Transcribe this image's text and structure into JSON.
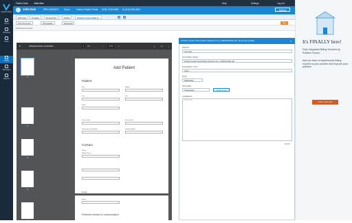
{
  "app": {
    "brand": "practice fusion"
  },
  "sidebar": {
    "items": [
      {
        "label": "Home"
      },
      {
        "label": "Schedule"
      },
      {
        "label": "Tasks"
      },
      {
        "label": "Charts"
      },
      {
        "label": "Messages"
      },
      {
        "label": "Reports"
      }
    ]
  },
  "topbar": {
    "patient_label": "Patient Data",
    "patient_name": "John Doe",
    "help": "Help",
    "settings": "Settings",
    "logout": "Log out"
  },
  "patient": {
    "name": "John Doe",
    "prn": "PRN: 00001971",
    "age": "43 yrs",
    "invite": "Invite to Patient Portal",
    "dob": "DOB: 07/01/1981",
    "mobile": "M: (310) 000-0001",
    "actions": "Actions"
  },
  "tabs": [
    "Summary",
    "Timeline",
    "Documents",
    "Profile",
    "Practice Fusion New P..."
  ],
  "subtabs": {
    "print_document": "Print document",
    "print_details": "Print details",
    "download": "Download",
    "sign": "Sign"
  },
  "attachments_label": "Attachment viewer",
  "viewer": {
    "filename": "d30a4d19-8e6c-4c69-8f2d-...",
    "page": "1",
    "total": "/ 6",
    "zoom": "67%"
  },
  "thumbs": [
    "1",
    "2",
    "3",
    "4",
    "5"
  ],
  "document": {
    "title": "Add Patient",
    "section_patient": "Patient",
    "section_contact": "Contact",
    "labels": [
      "First",
      "Middle",
      "Last",
      "Sex",
      "Suffix",
      "Previous name",
      "Date of birth",
      "Sex at birth",
      "Social Security Number",
      "Gender identity",
      "Phone",
      "Mobile Phone",
      "Email"
    ],
    "email_row": "Email",
    "preferred": "Preferred method of communication"
  },
  "panel": {
    "header": "Practice Fusion New Patient Sample Form_04092411001.pdf • Document details",
    "patient_label": "PATIENT",
    "patient_value": "John Doe",
    "name_label": "DOCUMENT NAME *",
    "name_value": "Practice Fusion New Patient Sample Form_04092411001.pdf",
    "type_label": "DOCUMENT TYPE *",
    "type_value": "Other",
    "date_label": "DATE",
    "date_value": "03/05/2024",
    "provider_label": "PROVIDER",
    "provider_value": "Unassigned",
    "assign": "Assign to me",
    "comments_label": "COMMENTS",
    "comments_placeholder": "Comment",
    "counter": "0/1000"
  },
  "ad": {
    "headline": "It's FINALLY here!",
    "line1": "Fully Integrated Billing Services by Practice Fusion.",
    "line2": "Add our team of experienced billing experts to your practice and improve your practice.",
    "cta": "Learn more now"
  },
  "colors": {
    "accent": "#1a86d4",
    "sidebar": "#1b2a3a",
    "orange": "#f08a24"
  }
}
